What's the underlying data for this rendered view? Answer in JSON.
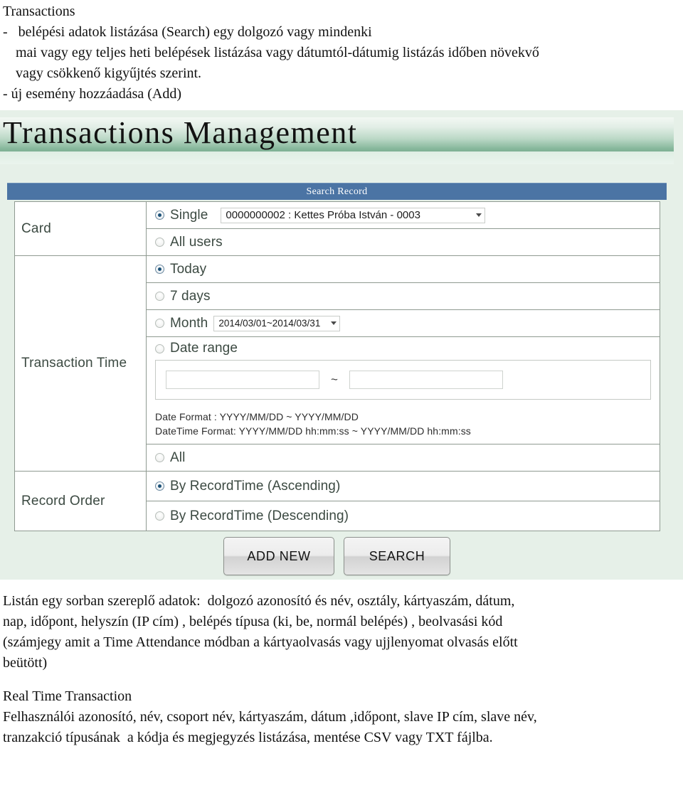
{
  "intro": {
    "heading": "Transactions",
    "lines": [
      "-   belépési adatok listázása (Search) egy dolgozó vagy mindenki",
      "mai vagy egy teljes heti belépések listázása vagy dátumtól-dátumig listázás időben növekvő",
      "vagy csökkenő kigyűjtés szerint.",
      "- új esemény hozzáadása (Add)"
    ]
  },
  "screenshot": {
    "title": "Transactions Management",
    "section_bar": "Search Record",
    "rows": {
      "card": {
        "label": "Card",
        "options": [
          {
            "label": "Single",
            "selected": true,
            "icon": "radio-icon"
          },
          {
            "label": "All users",
            "selected": false,
            "icon": "radio-icon"
          }
        ],
        "user_select": {
          "value": "0000000002 : Kettes Próba István - 0003",
          "icon": "chevron-down-icon"
        }
      },
      "transaction_time": {
        "label": "Transaction Time",
        "options": [
          {
            "label": "Today",
            "selected": true,
            "icon": "radio-icon"
          },
          {
            "label": "7 days",
            "selected": false,
            "icon": "radio-icon"
          },
          {
            "label": "Month",
            "selected": false,
            "icon": "radio-icon"
          },
          {
            "label": "Date range",
            "selected": false,
            "icon": "radio-icon"
          },
          {
            "label": "All",
            "selected": false,
            "icon": "radio-icon"
          }
        ],
        "month_select": {
          "value": "2014/03/01~2014/03/31",
          "icon": "chevron-down-icon"
        },
        "date_from": {
          "value": "",
          "placeholder": ""
        },
        "date_to": {
          "value": "",
          "placeholder": ""
        },
        "range_separator": "~",
        "hints": [
          "Date Format : YYYY/MM/DD  ~ YYYY/MM/DD",
          "DateTime Format: YYYY/MM/DD  hh:mm:ss ~ YYYY/MM/DD  hh:mm:ss"
        ]
      },
      "record_order": {
        "label": "Record Order",
        "options": [
          {
            "label": "By RecordTime (Ascending)",
            "selected": true,
            "icon": "radio-icon"
          },
          {
            "label": "By RecordTime (Descending)",
            "selected": false,
            "icon": "radio-icon"
          }
        ]
      }
    },
    "buttons": {
      "add_new": "ADD NEW",
      "search": "SEARCH"
    },
    "colors": {
      "panel_bg": "#e6f0e8",
      "title_gradient_end": "#7db094",
      "section_bar": "#4b74a4",
      "radio_selected": "#1c5177",
      "table_border": "#8f9a91"
    }
  },
  "outro": {
    "lines": [
      "Listán egy sorban szereplő adatok:  dolgozó azonosító és név, osztály, kártyaszám, dátum,",
      "nap, időpont, helyszín (IP cím) , belépés típusa (ki, be, normál belépés) , beolvasási kód",
      "(számjegy amit a Time Attendance módban a kártyaolvasás vagy ujjlenyomat olvasás előtt",
      "beütött)"
    ],
    "heading2": "Real Time Transaction",
    "lines2": [
      "Felhasználói azonosító, név, csoport név, kártyaszám, dátum ,időpont, slave IP cím, slave név,",
      "tranzakció típusának  a kódja és megjegyzés listázása, mentése CSV vagy TXT fájlba."
    ]
  }
}
